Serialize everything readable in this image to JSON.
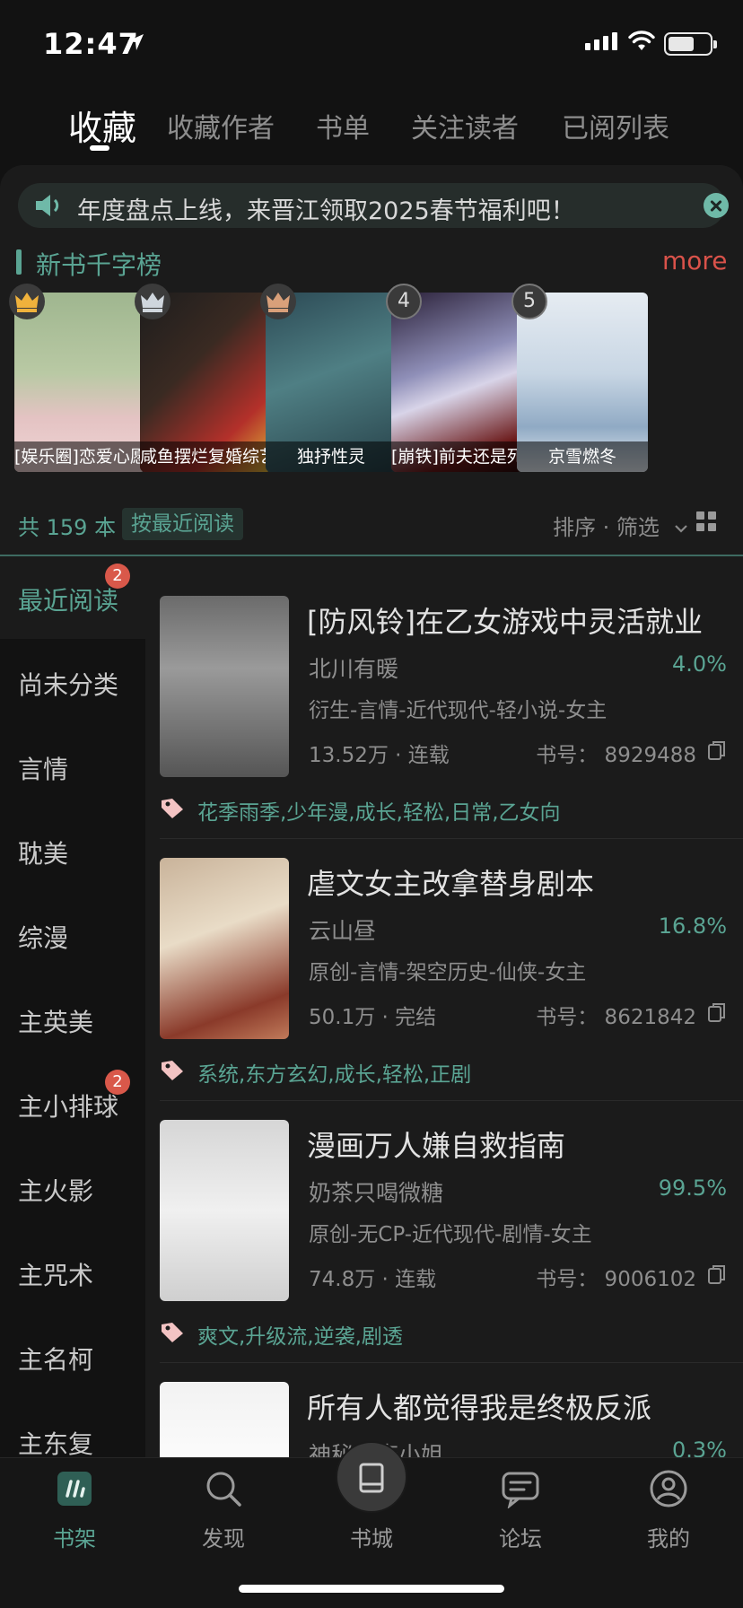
{
  "status": {
    "time": "12:47"
  },
  "tabs": [
    {
      "label": "收藏",
      "active": true
    },
    {
      "label": "收藏作者"
    },
    {
      "label": "书单"
    },
    {
      "label": "关注读者"
    },
    {
      "label": "已阅列表"
    }
  ],
  "notice": {
    "text": "年度盘点上线，来晋江领取2025春节福利吧！"
  },
  "rank": {
    "title": "新书千字榜",
    "more": "more",
    "items": [
      {
        "rank_badge": "crown-icon",
        "label": "[娱乐圈]恋爱心愿"
      },
      {
        "rank_badge": "crown-icon",
        "label": "咸鱼摆烂复婚综艺"
      },
      {
        "rank_badge": "crown-icon",
        "label": "独抒性灵"
      },
      {
        "rank_badge": "4",
        "label": "[崩铁]前夫还是死了"
      },
      {
        "rank_badge": "5",
        "label": "京雪燃冬"
      }
    ]
  },
  "summary": {
    "count": "共 159 本",
    "sort_chip": "按最近阅读",
    "sort_filter": "排序 · 筛选"
  },
  "nav": [
    {
      "label": "最近阅读",
      "active": true,
      "badge": "2"
    },
    {
      "label": "尚未分类"
    },
    {
      "label": "言情"
    },
    {
      "label": "耽美"
    },
    {
      "label": "综漫"
    },
    {
      "label": "主英美"
    },
    {
      "label": "主小排球",
      "badge": "2"
    },
    {
      "label": "主火影"
    },
    {
      "label": "主咒术"
    },
    {
      "label": "主名柯"
    },
    {
      "label": "主东复"
    }
  ],
  "books": [
    {
      "title": "[防风铃]在乙女游戏中灵活就业",
      "author": "北川有暖",
      "progress": "4.0%",
      "genre": "衍生-言情-近代现代-轻小说-女主",
      "stat": "13.52万 · 连载",
      "bookno": "书号： 8929488",
      "tags": "花季雨季,少年漫,成长,轻松,日常,乙女向"
    },
    {
      "title": "虐文女主改拿替身剧本",
      "author": "云山昼",
      "progress": "16.8%",
      "genre": "原创-言情-架空历史-仙侠-女主",
      "stat": "50.1万 · 完结",
      "bookno": "书号： 8621842",
      "tags": "系统,东方玄幻,成长,轻松,正剧"
    },
    {
      "title": "漫画万人嫌自救指南",
      "author": "奶茶只喝微糖",
      "progress": "99.5%",
      "genre": "原创-无CP-近代现代-剧情-女主",
      "stat": "74.8万 · 连载",
      "bookno": "书号： 9006102",
      "tags": "爽文,升级流,逆袭,剧透"
    },
    {
      "title": "所有人都觉得我是终极反派",
      "author": "神秘的李小姐",
      "progress": "0.3%"
    }
  ],
  "bottom_nav": [
    {
      "label": "书架",
      "active": true
    },
    {
      "label": "发现"
    },
    {
      "label": "书城"
    },
    {
      "label": "论坛"
    },
    {
      "label": "我的"
    }
  ],
  "colors": {
    "accent": "#5aa493",
    "more": "#d9524a",
    "badge": "#d9584a",
    "bg": "#121212",
    "panel": "#1b1b1b"
  }
}
